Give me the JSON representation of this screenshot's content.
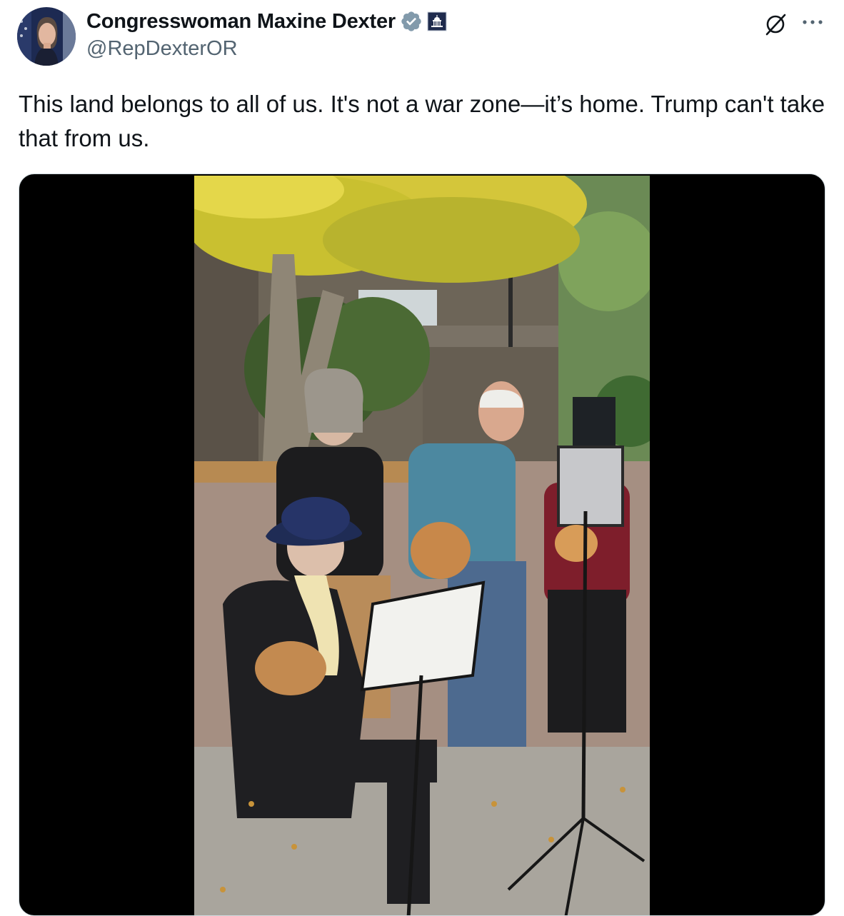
{
  "tweet": {
    "author": {
      "display_name": "Congresswoman Maxine Dexter",
      "handle": "@RepDexterOR",
      "verified": true,
      "verified_color": "#829aab",
      "affiliation_icon": "capitol-badge-icon"
    },
    "text": "This land belongs to all of us. It's not a war zone—it’s home. Trump can't take that from us.",
    "media": {
      "type": "video"
    },
    "actions": {
      "grok_icon": "grok-icon",
      "more_icon": "more-options-icon"
    }
  },
  "colors": {
    "text_primary": "#0f1419",
    "text_secondary": "#536471",
    "border": "#cfd9de"
  }
}
